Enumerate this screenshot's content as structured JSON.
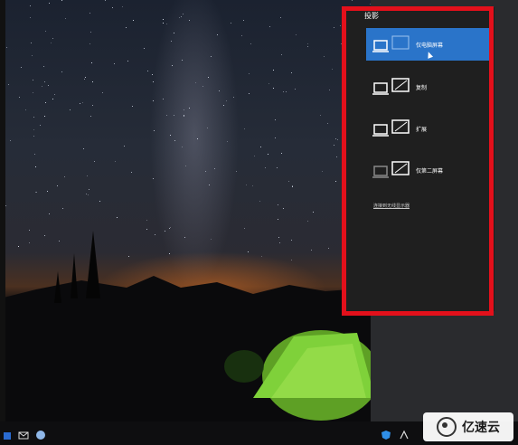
{
  "panel": {
    "title": "投影",
    "options": [
      {
        "id": "pc-only",
        "label": "仅电脑屏幕",
        "selected": true
      },
      {
        "id": "duplicate",
        "label": "复制",
        "selected": false
      },
      {
        "id": "extend",
        "label": "扩展",
        "selected": false
      },
      {
        "id": "second-only",
        "label": "仅第二屏幕",
        "selected": false
      }
    ],
    "connect_link": "连接到无线显示器"
  },
  "watermark": {
    "text": "亿速云"
  },
  "colors": {
    "selected_bg": "#2a74c9",
    "panel_bg": "#1f1f1f",
    "highlight_border": "#e3101b"
  }
}
